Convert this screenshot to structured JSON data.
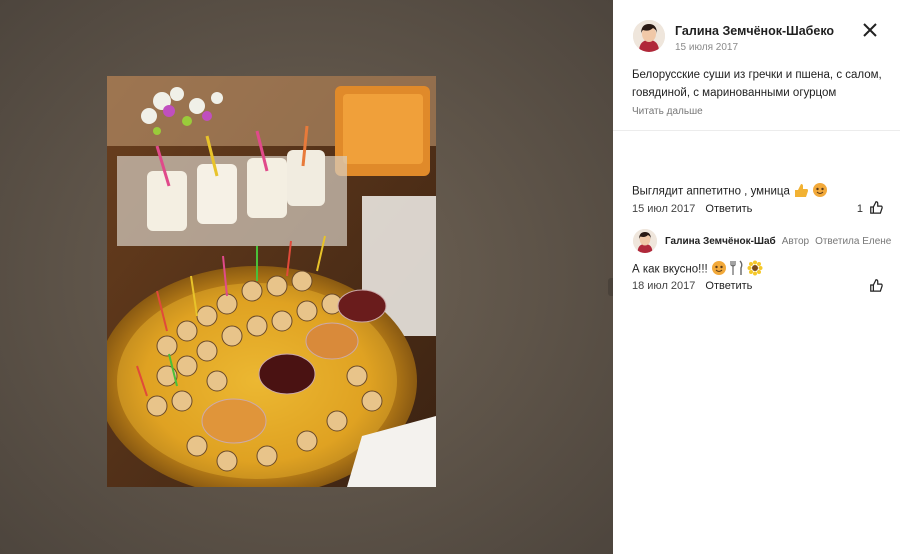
{
  "post": {
    "author": "Галина Земчёнок-Шабеко",
    "date": "15 июля 2017",
    "caption": "Белорусские суши из гречки и пшена, с салом, говядиной, с маринованными огурцом",
    "read_more": "Читать дальше"
  },
  "comments": [
    {
      "text": "Выглядит аппетитно , умница",
      "emoji": [
        "thumbs-up-icon",
        "smiling-face-icon"
      ],
      "date": "15 июл 2017",
      "reply_label": "Ответить",
      "likes": "1"
    }
  ],
  "reply": {
    "author": "Галина Земчёнок-Шаб",
    "badge": "Автор",
    "answered": "Ответила Елене",
    "text": "А как вкусно!!!",
    "emoji": [
      "smiling-face-icon",
      "fork-knife-icon",
      "sunflower-icon"
    ],
    "date": "18 июл 2017",
    "reply_label": "Ответить"
  },
  "icons": {
    "close": "close-icon",
    "like": "thumbs-up-outline-icon"
  },
  "colors": {
    "photo_bg": "#5d5348",
    "text": "#222222",
    "muted": "#8a8a8a"
  }
}
